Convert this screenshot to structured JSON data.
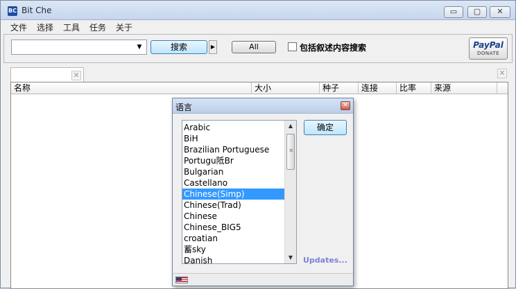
{
  "window": {
    "title": "Bit Che",
    "app_icon": "BC"
  },
  "window_controls": {
    "minimize": "▭",
    "maximize": "▢",
    "close": "✕"
  },
  "menu": [
    "文件",
    "选择",
    "工具",
    "任务",
    "关于"
  ],
  "toolbar": {
    "search_value": "",
    "search_button": "搜索",
    "all_button": "All",
    "checkbox_label": "包括叙述内容搜索",
    "checkbox_checked": false,
    "paypal_word": "PayPal",
    "paypal_donate": "DONATE"
  },
  "tab": {
    "label": ""
  },
  "columns": [
    "名称",
    "大小",
    "种子",
    "连接",
    "比率",
    "来源"
  ],
  "dialog": {
    "title": "语言",
    "ok_button": "确定",
    "updates_link": "Updates...",
    "selected_language": "Chinese(Simp)",
    "languages": [
      "Arabic",
      "BiH",
      "Brazilian Portuguese",
      "Portugu阺Br",
      "Bulgarian",
      "Castellano",
      "Chinese(Simp)",
      "Chinese(Trad)",
      "Chinese",
      "Chinese_BIG5",
      "croatian",
      "蓄sky",
      "Danish"
    ],
    "status_flag": "us-flag-icon"
  },
  "colors": {
    "selection": "#3399ff",
    "updates_link": "#7b83d6",
    "titlebar": "#c6d6ec"
  }
}
